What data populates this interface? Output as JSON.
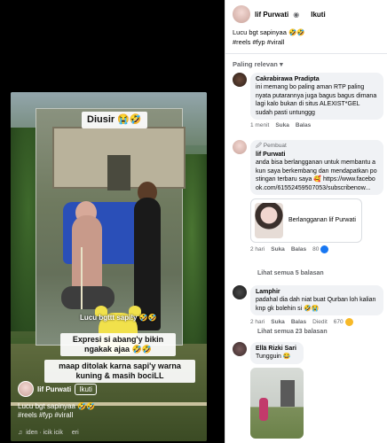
{
  "reel": {
    "overlay_diusir": "Diusir 😭🤣",
    "overlay_lucu": "Lucu bgttt sapi!y 🤣🤣",
    "overlay_expresi": "Expresi si abang'y bikin ngakak ajaa 🤣🤣",
    "overlay_maap": "maap ditolak karna sapi'y warna kuning & masih bociLL",
    "author": "lif Purwati",
    "follow_label": "Ikuti",
    "caption_line1": "Lucu bgt sapinyaa 🤣🤣",
    "caption_line2": "#reels #fyp #virall",
    "audio_icon": "music-note-icon",
    "audio_text": "iden · icik icik",
    "audio_text2": "eri"
  },
  "panel": {
    "author": "lif Purwati",
    "follow_label": "Ikuti",
    "caption_line1": "Lucu bgt sapinyaa 🤣🤣",
    "caption_line2": "#reels #fyp #virall",
    "sort_label": "Paling relevan ▾"
  },
  "comments": [
    {
      "name": "Cakrabirawa Pradipta",
      "text": "ini memang bo paling aman RTP paling nyata putarannya juga bagus bagus dimana lagi kalo bukan di situs ALEXIST*GEL sudah pasti untunggg",
      "time": "1 menit",
      "like": "Suka",
      "reply": "Balas"
    },
    {
      "tag": "🖉 Pembuat",
      "name": "lif Purwati",
      "text": "anda bisa berlangganan untuk membantu akun saya berkembang dan mendapatkan postingan terbaru saya 🥰 https://www.facebook.com/61552459507053/subscribenow...",
      "card_text": "Berlangganan lif Purwati",
      "time": "2 hari",
      "like": "Suka",
      "reply": "Balas",
      "count": "80",
      "replies_label": "Lihat semua 5 balasan"
    },
    {
      "name": "Lamphir",
      "text": "padahal dia dah niat buat Qurban loh kalian knp gk bolehin si 🤣😭",
      "time": "2 hari",
      "like": "Suka",
      "reply": "Balas",
      "edited": "Diedit",
      "count": "670",
      "replies_label": "Lihat semua 23 balasan"
    },
    {
      "name": "Ellä Rizki Sari",
      "text": "Tungguin 😂"
    }
  ]
}
